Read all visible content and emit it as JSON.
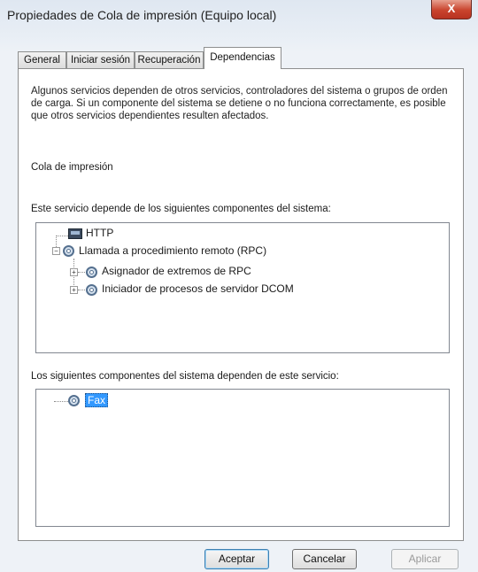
{
  "window": {
    "title": "Propiedades de Cola de impresión (Equipo local)",
    "close_glyph": "X"
  },
  "tabs": [
    {
      "label": "General"
    },
    {
      "label": "Iniciar sesión"
    },
    {
      "label": "Recuperación"
    },
    {
      "label": "Dependencias",
      "active": true
    }
  ],
  "dependencies": {
    "description": "Algunos servicios dependen de otros servicios, controladores del sistema o grupos de orden de carga. Si un componente del sistema se detiene o no funciona correctamente, es posible que otros servicios dependientes resulten afectados.",
    "service_name": "Cola de impresión",
    "depends_on_label": "Este servicio depende de los siguientes componentes del sistema:",
    "depends_on_tree": [
      {
        "label": "HTTP",
        "icon": "driver-icon",
        "level": 0
      },
      {
        "label": "Llamada a procedimiento remoto (RPC)",
        "icon": "gear-icon",
        "level": 0,
        "expanded": true
      },
      {
        "label": "Asignador de extremos de RPC",
        "icon": "gear-icon",
        "level": 1,
        "expanded": false
      },
      {
        "label": "Iniciador de procesos de servidor DCOM",
        "icon": "gear-icon",
        "level": 1,
        "expanded": false
      }
    ],
    "dependents_label": "Los siguientes componentes del sistema dependen de este servicio:",
    "dependents_tree": [
      {
        "label": "Fax",
        "icon": "gear-icon",
        "selected": true
      }
    ]
  },
  "buttons": {
    "ok": "Aceptar",
    "cancel": "Cancelar",
    "apply": "Aplicar"
  },
  "colors": {
    "selection": "#3399ff",
    "close_button": "#c9442d"
  }
}
